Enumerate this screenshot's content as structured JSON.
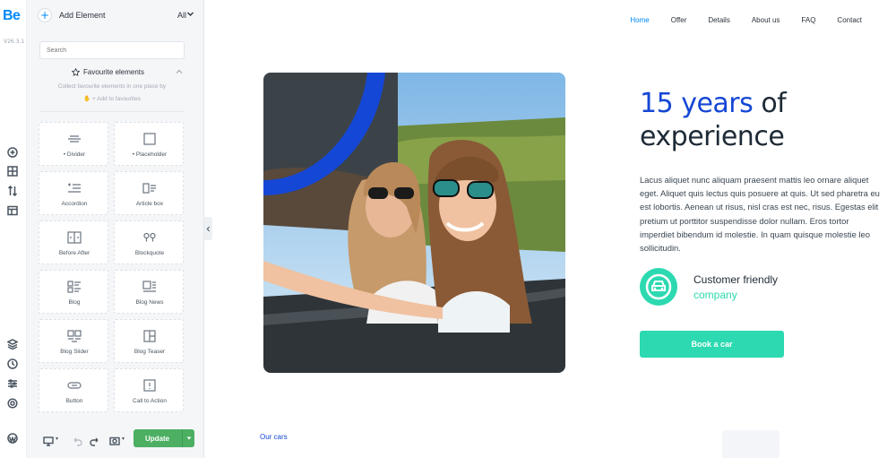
{
  "brand": {
    "logo": "Be",
    "version": "V26.3.1",
    "accent": "#0089f7"
  },
  "rail": {
    "icons": [
      "add-circle-icon",
      "layout-icon",
      "sort-icon",
      "window-icon",
      "layers-icon",
      "history-icon",
      "sliders-icon",
      "settings-icon",
      "wordpress-icon"
    ]
  },
  "panel": {
    "title": "Add Element",
    "filter": "All",
    "search_placeholder": "Search",
    "favourites": {
      "title": "Favourite elements",
      "hint": "Collect favourite elements in one place by",
      "add_hint": "+ Add to favourites"
    },
    "elements": [
      {
        "label": "• Divider",
        "icon": "divider-icon"
      },
      {
        "label": "• Placeholder",
        "icon": "placeholder-icon"
      },
      {
        "label": "Accordion",
        "icon": "accordion-icon"
      },
      {
        "label": "Article box",
        "icon": "article-box-icon"
      },
      {
        "label": "Before After",
        "icon": "before-after-icon"
      },
      {
        "label": "Blockquote",
        "icon": "blockquote-icon"
      },
      {
        "label": "Blog",
        "icon": "blog-icon"
      },
      {
        "label": "Blog News",
        "icon": "blog-news-icon"
      },
      {
        "label": "Blog Slider",
        "icon": "blog-slider-icon"
      },
      {
        "label": "Blog Teaser",
        "icon": "blog-teaser-icon"
      },
      {
        "label": "Button",
        "icon": "button-icon"
      },
      {
        "label": "Call to Action",
        "icon": "call-to-action-icon"
      }
    ],
    "footer": {
      "update_label": "Update",
      "update_color": "#4caf62"
    }
  },
  "preview": {
    "nav": [
      "Home",
      "Offer",
      "Details",
      "About us",
      "FAQ",
      "Contact"
    ],
    "nav_active": "Home",
    "headline_highlight": "15 years",
    "headline_rest_1": " of",
    "headline_rest_2": "experience",
    "body": "Lacus aliquet nunc aliquam praesent mattis leo ornare aliquet eget. Aliquet quis lectus quis posuere at quis. Ut sed pharetra eu est lobortis. Aenean ut risus, nisl cras est nec, risus. Egestas elit pretium ut porttitor suspendisse dolor nullam. Eros tortor imperdiet bibendum id molestie. In quam quisque molestie leo sollicitudin.",
    "feature_title": "Customer friendly",
    "feature_sub": "company",
    "cta": "Book a car",
    "section_label": "Our cars",
    "colors": {
      "primary": "#1547d6",
      "teal": "#2cd9b0",
      "text": "#1e2a36"
    }
  }
}
